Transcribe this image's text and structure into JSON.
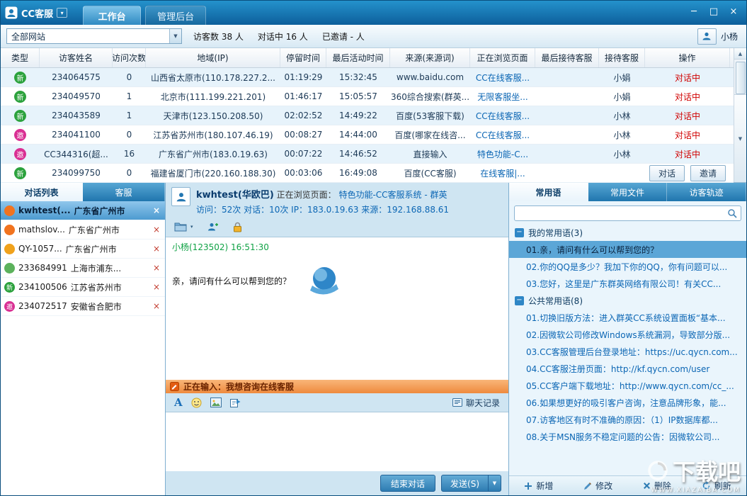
{
  "glyphs": {
    "dropdown": "▼",
    "small_dropdown": "▾",
    "close": "×",
    "minimize": "─",
    "maximize": "□",
    "minus": "−",
    "scroll_up": "▲",
    "scroll_down": "▼"
  },
  "window": {
    "app_title": "CC客服",
    "nav_tabs": [
      {
        "label": "工作台",
        "state": "active"
      },
      {
        "label": "管理后台",
        "state": ""
      }
    ]
  },
  "toolbar": {
    "site_filter": "全部网站",
    "stats": {
      "visitors": "访客数 38 人",
      "in_chat": "对话中 16 人",
      "invited": "已邀请 - 人"
    },
    "user": "小杨"
  },
  "visitor_table": {
    "columns": [
      "类型",
      "访客姓名",
      "访问次数",
      "地域(IP)",
      "停留时间",
      "最后活动时间",
      "来源(来源词)",
      "正在浏览页面",
      "最后接待客服",
      "接待客服",
      "操作"
    ],
    "rows": [
      {
        "type_char": "新",
        "type_class": "t-new",
        "name": "234064575",
        "visits": "0",
        "region": "山西省太原市(110.178.227.2...",
        "stay": "01:19:29",
        "last_active": "15:32:45",
        "source": "www.baidu.com",
        "page": "CC在线客服...",
        "last_agent": "",
        "agent": "小娟",
        "status": "对话中",
        "action_kind": "mode-status"
      },
      {
        "type_char": "新",
        "type_class": "t-new",
        "name": "234049570",
        "visits": "1",
        "region": "北京市(111.199.221.201)",
        "stay": "01:46:17",
        "last_active": "15:05:57",
        "source": "360综合搜索(群英...",
        "page": "无限客服坐...",
        "last_agent": "",
        "agent": "小娟",
        "status": "对话中",
        "action_kind": "mode-status"
      },
      {
        "type_char": "新",
        "type_class": "t-new",
        "name": "234043589",
        "visits": "1",
        "region": "天津市(123.150.208.50)",
        "stay": "02:02:52",
        "last_active": "14:49:22",
        "source": "百度(53客服下载)",
        "page": "CC在线客服...",
        "last_agent": "",
        "agent": "小林",
        "status": "对话中",
        "action_kind": "mode-status"
      },
      {
        "type_char": "邀",
        "type_class": "t-inv",
        "name": "234041100",
        "visits": "0",
        "region": "江苏省苏州市(180.107.46.19)",
        "stay": "00:08:27",
        "last_active": "14:44:00",
        "source": "百度(哪家在线咨...",
        "page": "CC在线客服...",
        "last_agent": "",
        "agent": "小林",
        "status": "对话中",
        "action_kind": "mode-status"
      },
      {
        "type_char": "邀",
        "type_class": "t-inv",
        "name": "CC344316(超...",
        "visits": "16",
        "region": "广东省广州市(183.0.19.63)",
        "stay": "00:07:22",
        "last_active": "14:46:52",
        "source": "直接输入",
        "page": "特色功能-C...",
        "last_agent": "",
        "agent": "小林",
        "status": "对话中",
        "action_kind": "mode-status"
      },
      {
        "type_char": "新",
        "type_class": "t-new",
        "name": "234099750",
        "visits": "0",
        "region": "福建省厦门市(220.160.188.30)",
        "stay": "00:03:06",
        "last_active": "16:49:08",
        "source": "百度(CC客服)",
        "page": "在线客服|...",
        "last_agent": "",
        "agent": "",
        "status": "",
        "action_kind": "mode-buttons",
        "btn1": "对话",
        "btn2": "邀请"
      }
    ]
  },
  "left_panel": {
    "tabs": [
      {
        "label": "对话列表",
        "state": "active"
      },
      {
        "label": "客服",
        "state": ""
      }
    ],
    "items": [
      {
        "icon_class": "ic-orange",
        "icon_char": "",
        "name": "kwhtest(...",
        "region": "广东省广州市",
        "state": "selected"
      },
      {
        "icon_class": "ic-orange",
        "icon_char": "",
        "name": "mathslov...",
        "region": "广东省广州市",
        "state": ""
      },
      {
        "icon_class": "ic-orange2",
        "icon_char": "",
        "name": "QY-1057...",
        "region": "广东省广州市",
        "state": ""
      },
      {
        "icon_class": "ic-green2",
        "icon_char": "",
        "name": "233684991",
        "region": "上海市浦东...",
        "state": ""
      },
      {
        "icon_class": "ic-green",
        "icon_char": "新",
        "name": "234100506",
        "region": "江苏省苏州市",
        "state": ""
      },
      {
        "icon_class": "ic-magenta",
        "icon_char": "邀",
        "name": "234072517",
        "region": "安徽省合肥市",
        "state": ""
      }
    ]
  },
  "chat": {
    "visitor_name": "kwhtest(华欧巴)",
    "browsing_label": "正在浏览页面：",
    "browsing_page": "特色功能-CC客服系统 - 群英",
    "meta": "访问：52次 对话：10次 IP：183.0.19.63 来源：192.168.88.61",
    "message": {
      "sender": "小杨(123502)",
      "time": "16:51:30",
      "text": "亲，请问有什么可以帮到您的？"
    },
    "typing_text": "正在输入：我想咨询在线客服",
    "font_icon_label": "A",
    "history_label": "聊天记录",
    "end_button": "结束对话",
    "send_button": "发送(S)"
  },
  "right_panel": {
    "tabs": [
      {
        "label": "常用语",
        "state": "active"
      },
      {
        "label": "常用文件",
        "state": ""
      },
      {
        "label": "访客轨迹",
        "state": ""
      }
    ],
    "group1": {
      "title": "我的常用语(3)",
      "items": [
        {
          "text": "01.亲，请问有什么可以帮到您的？",
          "state": "selected"
        },
        {
          "text": "02.你的QQ是多少？我加下你的QQ，你有问题可以...",
          "state": ""
        },
        {
          "text": "03.您好，这里是广东群英网络有限公司！有关CC...",
          "state": ""
        }
      ]
    },
    "group2": {
      "title": "公共常用语(8)",
      "items": [
        {
          "text": "01.切换旧版方法：进入群英CC系统设置面板“基本...",
          "state": ""
        },
        {
          "text": "02.因微软公司修改Windows系统漏洞，导致部分版...",
          "state": ""
        },
        {
          "text": "03.CC客服管理后台登录地址：https://uc.qycn.com...",
          "state": ""
        },
        {
          "text": "04.CC客服注册页面：http://kf.qycn.com/user",
          "state": ""
        },
        {
          "text": "05.CC客户端下载地址：http://www.qycn.com/cc_...",
          "state": ""
        },
        {
          "text": "06.如果想更好的吸引客户咨询，注意品牌形象，能...",
          "state": ""
        },
        {
          "text": "07.访客地区有时不准确的原因：（1）IP数据库都...",
          "state": ""
        },
        {
          "text": "08.关于MSN服务不稳定问题的公告：因微软公司...",
          "state": ""
        }
      ]
    },
    "actions": [
      {
        "label": "新增"
      },
      {
        "label": "修改"
      },
      {
        "label": "删除"
      },
      {
        "label": "刷新"
      }
    ]
  },
  "watermark": {
    "title": "下载吧",
    "subtitle": "WWW.XIAZAIBA.COM"
  }
}
